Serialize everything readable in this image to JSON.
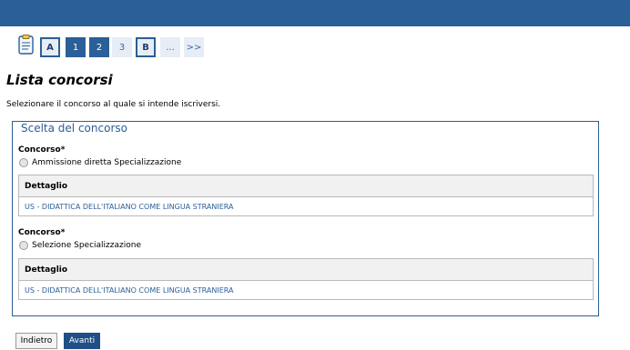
{
  "steps": {
    "items": [
      {
        "label": "A"
      },
      {
        "label": "1"
      },
      {
        "label": "2"
      },
      {
        "label": "3"
      },
      {
        "label": "B"
      },
      {
        "label": "..."
      },
      {
        "label": ">>"
      }
    ]
  },
  "page": {
    "title": "Lista concorsi",
    "intro": "Selezionare il concorso al quale si intende iscriversi."
  },
  "fieldset": {
    "legend": "Scelta del concorso",
    "concorsi": [
      {
        "label": "Concorso*",
        "option": "Ammissione diretta Specializzazione",
        "detail_header": "Dettaglio",
        "detail_value": "US - DIDATTICA DELL'ITALIANO COME LINGUA STRANIERA"
      },
      {
        "label": "Concorso*",
        "option": "Selezione Specializzazione",
        "detail_header": "Dettaglio",
        "detail_value": "US - DIDATTICA DELL'ITALIANO COME LINGUA STRANIERA"
      }
    ]
  },
  "buttons": {
    "back": "Indietro",
    "next": "Avanti"
  },
  "colors": {
    "brand": "#2a5f97",
    "button_primary": "#1f4f86"
  },
  "icons": {
    "step_icon": "clipboard-icon",
    "radio": "radio-icon"
  }
}
